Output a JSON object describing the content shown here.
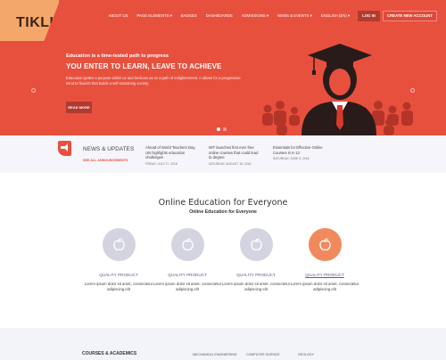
{
  "brand": {
    "logo": "TIKLI"
  },
  "nav": {
    "items": [
      "About Us",
      "Page Elements ▾",
      "Badges",
      "Dashboards",
      "Admissions ▾",
      "News & Events ▾",
      "English (EN) ▾"
    ],
    "login_label": "Log In",
    "create_label": "Create New Account"
  },
  "hero": {
    "subtitle": "Education is a time-tested path to progress",
    "title": "YOU ENTER TO LEARN, LEAVE TO ACHIEVE",
    "description": "Education ignites a purpose within us and beckons us on a path of enlightenment. It allows for a progressive mind to flourish that builds a self-sustaining society.",
    "button": "Read More"
  },
  "news": {
    "title": "News & Updates",
    "link": "See All Announcements",
    "items": [
      {
        "text": "Ahead of World Teachers Day, UN highlights education challenges",
        "date": "Friday, July 27, 2018"
      },
      {
        "text": "MIT launches first ever free online courses that could lead to degree",
        "date": "Saturday, August 18, 2018"
      },
      {
        "text": "Essentials for Effective Online Courses in K-12",
        "date": "Saturday, June 9, 2018"
      }
    ]
  },
  "education": {
    "title": "Online Education for Everyone",
    "subtitle": "Online Education for Everyone",
    "features": [
      {
        "label": "Quality Product",
        "desc": "Lorem ipsum dolor sit amet, consectetur adipiscing elit"
      },
      {
        "label": "Quality Product",
        "desc": "Lorem ipsum dolor sit amet, consectetur adipiscing elit"
      },
      {
        "label": "Quality Product",
        "desc": "Lorem ipsum dolor sit amet, consectetur adipiscing elit"
      },
      {
        "label": "Quality Product",
        "desc": "Lorem ipsum dolor sit amet, consectetur adipiscing elit"
      }
    ]
  },
  "footer": {
    "title": "Courses & Academics",
    "links": [
      "Mechanical Engineering",
      "Computer Science",
      "Geology"
    ]
  },
  "colors": {
    "hero_bg": "#e8503e",
    "accent_orange": "#f08a5d",
    "feature_circle": "#d3d4df",
    "news_bg": "#f5f5fb"
  },
  "icons": {
    "news": "megaphone-icon",
    "feature": "apple-icon"
  }
}
